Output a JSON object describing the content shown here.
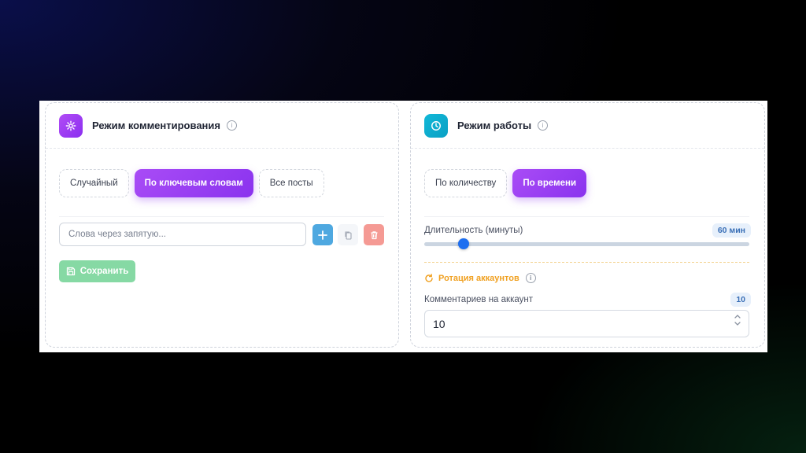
{
  "left_panel": {
    "title": "Режим комментирования",
    "icon": "gear-icon",
    "modes": [
      {
        "label": "Случайный",
        "active": false
      },
      {
        "label": "По ключевым словам",
        "active": true
      },
      {
        "label": "Все посты",
        "active": false
      }
    ],
    "keywords_input": {
      "placeholder": "Слова через запятую...",
      "value": ""
    },
    "save_label": "Сохранить"
  },
  "right_panel": {
    "title": "Режим работы",
    "icon": "clock-icon",
    "modes": [
      {
        "label": "По количеству",
        "active": false
      },
      {
        "label": "По времени",
        "active": true
      }
    ],
    "duration": {
      "label": "Длительность (минуты)",
      "badge": "60 мин",
      "level": 0.12
    },
    "rotation": {
      "label": "Ротация аккаунтов"
    },
    "comments_per_account": {
      "label": "Комментариев на аккаунт",
      "badge": "10",
      "value": "10"
    }
  },
  "colors": {
    "accent_purple": "#9b3ff2",
    "accent_teal": "#0fb0d0",
    "add_blue": "#4ea8e0",
    "delete_red": "#f59a94",
    "save_green": "#86d9a4",
    "slider_blue": "#1e6ff0",
    "rotation_orange": "#f0a020"
  }
}
